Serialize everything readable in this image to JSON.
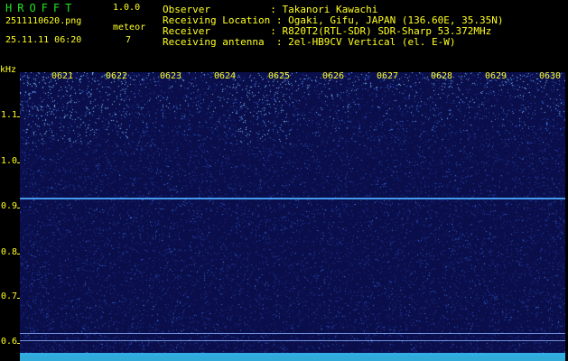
{
  "header": {
    "app_name": "HROFFT",
    "app_version": "1.0.0",
    "file_name": "2511110620.png",
    "datetime": "25.11.11 06:20",
    "meteor_label": "meteor",
    "meteor_count": "7",
    "info": [
      "Observer          : Takanori Kawachi",
      "Receiving Location : Ogaki, Gifu, JAPAN (136.60E, 35.35N)",
      "Receiver          : R820T2(RTL-SDR) SDR-Sharp 53.372MHz",
      "Receiving antenna  : 2el-HB9CV Vertical (el. E-W)"
    ]
  },
  "axis": {
    "unit": "kHz",
    "y_labels": [
      "1.1",
      "1.0",
      "0.9",
      "0.8",
      "0.7",
      "0.6"
    ],
    "x_labels": [
      "0621",
      "0622",
      "0623",
      "0624",
      "0625",
      "0626",
      "0627",
      "0628",
      "0629",
      "0630"
    ]
  },
  "spectrogram": {
    "background_color": "#0a0e4a",
    "signal_color": "#4aa8ff",
    "signal_frequency_khz": 0.92,
    "noise_floor_color": "#38c8ff"
  }
}
